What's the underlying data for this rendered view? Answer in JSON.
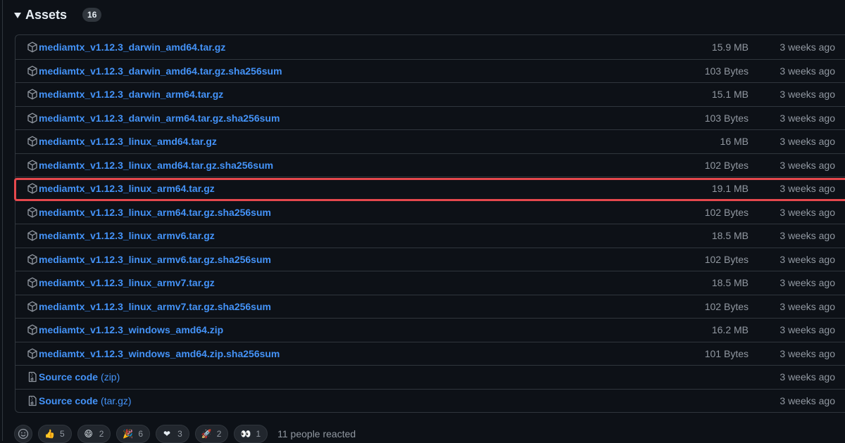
{
  "assets": {
    "title": "Assets",
    "count": "16",
    "files": [
      {
        "name": "mediamtx_v1.12.3_darwin_amd64.tar.gz",
        "size": "15.9 MB",
        "date": "3 weeks ago"
      },
      {
        "name": "mediamtx_v1.12.3_darwin_amd64.tar.gz.sha256sum",
        "size": "103 Bytes",
        "date": "3 weeks ago"
      },
      {
        "name": "mediamtx_v1.12.3_darwin_arm64.tar.gz",
        "size": "15.1 MB",
        "date": "3 weeks ago"
      },
      {
        "name": "mediamtx_v1.12.3_darwin_arm64.tar.gz.sha256sum",
        "size": "103 Bytes",
        "date": "3 weeks ago"
      },
      {
        "name": "mediamtx_v1.12.3_linux_amd64.tar.gz",
        "size": "16 MB",
        "date": "3 weeks ago"
      },
      {
        "name": "mediamtx_v1.12.3_linux_amd64.tar.gz.sha256sum",
        "size": "102 Bytes",
        "date": "3 weeks ago"
      },
      {
        "name": "mediamtx_v1.12.3_linux_arm64.tar.gz",
        "size": "19.1 MB",
        "date": "3 weeks ago"
      },
      {
        "name": "mediamtx_v1.12.3_linux_arm64.tar.gz.sha256sum",
        "size": "102 Bytes",
        "date": "3 weeks ago"
      },
      {
        "name": "mediamtx_v1.12.3_linux_armv6.tar.gz",
        "size": "18.5 MB",
        "date": "3 weeks ago"
      },
      {
        "name": "mediamtx_v1.12.3_linux_armv6.tar.gz.sha256sum",
        "size": "102 Bytes",
        "date": "3 weeks ago"
      },
      {
        "name": "mediamtx_v1.12.3_linux_armv7.tar.gz",
        "size": "18.5 MB",
        "date": "3 weeks ago"
      },
      {
        "name": "mediamtx_v1.12.3_linux_armv7.tar.gz.sha256sum",
        "size": "102 Bytes",
        "date": "3 weeks ago"
      },
      {
        "name": "mediamtx_v1.12.3_windows_amd64.zip",
        "size": "16.2 MB",
        "date": "3 weeks ago"
      },
      {
        "name": "mediamtx_v1.12.3_windows_amd64.zip.sha256sum",
        "size": "101 Bytes",
        "date": "3 weeks ago"
      }
    ],
    "source": [
      {
        "label": "Source code",
        "ext": "(zip)",
        "date": "3 weeks ago"
      },
      {
        "label": "Source code",
        "ext": "(tar.gz)",
        "date": "3 weeks ago"
      }
    ]
  },
  "reactions": {
    "items": [
      {
        "icon": "thumbs-up-icon",
        "emoji": "👍",
        "count": "5"
      },
      {
        "icon": "laugh-icon",
        "emoji": "😄",
        "count": "2"
      },
      {
        "icon": "hooray-icon",
        "emoji": "🎉",
        "count": "6"
      },
      {
        "icon": "heart-icon",
        "emoji": "❤",
        "count": "3"
      },
      {
        "icon": "rocket-icon",
        "emoji": "🚀",
        "count": "2"
      },
      {
        "icon": "eyes-icon",
        "emoji": "👀",
        "count": "1"
      }
    ],
    "summary": "11 people reacted"
  },
  "colors": {
    "background": "#0d1117",
    "link": "#4493f8",
    "muted": "#9198a1",
    "border": "#30363d",
    "highlight": "#e5484d"
  }
}
